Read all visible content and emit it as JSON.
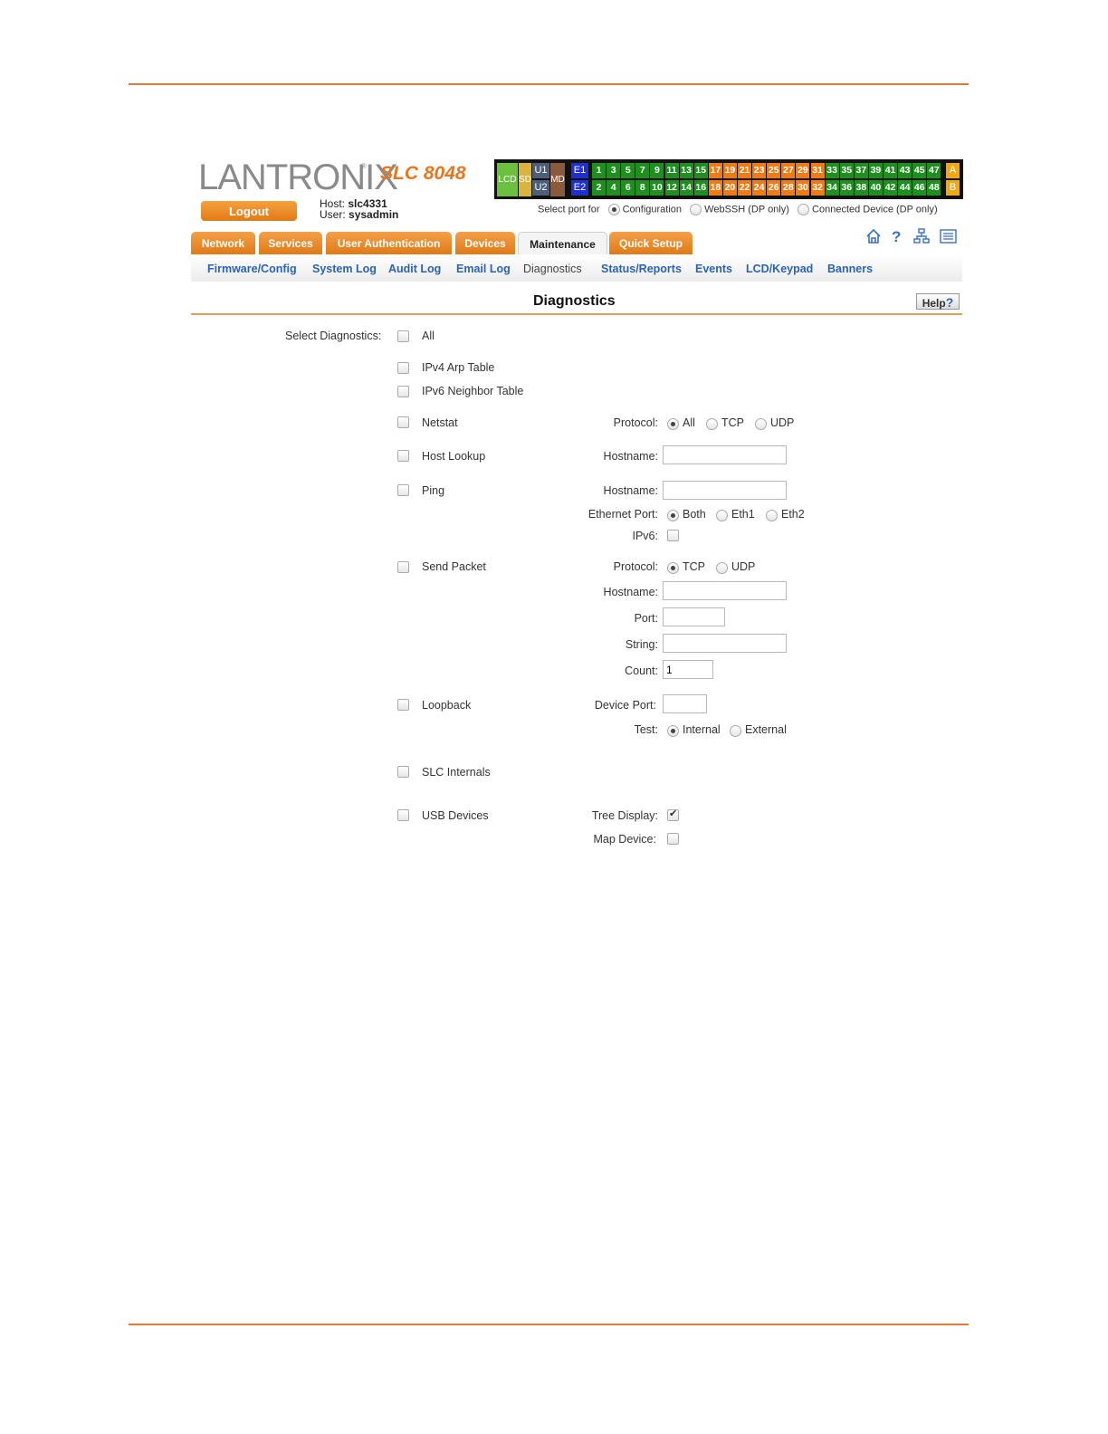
{
  "header": {
    "logo_text": "LANTRONIX",
    "logo_mark": "®",
    "model": "SLC 8048",
    "logout_label": "Logout",
    "host_label": "Host:",
    "host_value": "slc4331",
    "user_label": "User:",
    "user_value": "sysadmin"
  },
  "port_panel": {
    "lcd": "LCD",
    "sd": "SD",
    "u1": "U1",
    "u2": "U2",
    "md": "MD",
    "e1": "E1",
    "e2": "E2",
    "a": "A",
    "b": "B",
    "top_ports": [
      "1",
      "3",
      "5",
      "7",
      "9",
      "11",
      "13",
      "15",
      "17",
      "19",
      "21",
      "23",
      "25",
      "27",
      "29",
      "31",
      "33",
      "35",
      "37",
      "39",
      "41",
      "43",
      "45",
      "47"
    ],
    "bottom_ports": [
      "2",
      "4",
      "6",
      "8",
      "10",
      "12",
      "14",
      "16",
      "18",
      "20",
      "22",
      "24",
      "26",
      "28",
      "30",
      "32",
      "34",
      "36",
      "38",
      "40",
      "42",
      "44",
      "46",
      "48"
    ],
    "colors": {
      "green": "#1f8f1f",
      "orange": "#f07a14",
      "blue": "#1f2fd0",
      "lcd": "#6cc040",
      "sd": "#d8b53c",
      "u": "#4f5e78",
      "md": "#8a5a3c",
      "ab": "#f0a818"
    }
  },
  "select_port": {
    "label": "Select port for",
    "options": [
      "Configuration",
      "WebSSH (DP only)",
      "Connected Device (DP only)"
    ],
    "selected": "Configuration"
  },
  "tabs": [
    "Network",
    "Services",
    "User Authentication",
    "Devices",
    "Maintenance",
    "Quick Setup"
  ],
  "active_tab": "Maintenance",
  "nav_icons": [
    "home-icon",
    "help-icon",
    "sitemap-icon",
    "list-icon"
  ],
  "subnav": [
    "Firmware/Config",
    "System Log",
    "Audit Log",
    "Email Log",
    "Diagnostics",
    "Status/Reports",
    "Events",
    "LCD/Keypad",
    "Banners"
  ],
  "current_subnav": "Diagnostics",
  "page": {
    "title": "Diagnostics",
    "help_label": "Help",
    "help_mark": "?"
  },
  "form": {
    "select_label": "Select Diagnostics:",
    "items": {
      "all": "All",
      "ipv4": "IPv4 Arp Table",
      "ipv6": "IPv6 Neighbor Table",
      "netstat": "Netstat",
      "hostlookup": "Host Lookup",
      "ping": "Ping",
      "sendpacket": "Send Packet",
      "loopback": "Loopback",
      "slc": "SLC Internals",
      "usb": "USB Devices"
    },
    "netstat": {
      "protocol_label": "Protocol:",
      "options": [
        "All",
        "TCP",
        "UDP"
      ],
      "selected": "All"
    },
    "hostlookup": {
      "hostname_label": "Hostname:",
      "hostname": ""
    },
    "ping": {
      "hostname_label": "Hostname:",
      "hostname": "",
      "eth_label": "Ethernet Port:",
      "eth_options": [
        "Both",
        "Eth1",
        "Eth2"
      ],
      "eth_selected": "Both",
      "ipv6_label": "IPv6:",
      "ipv6": false
    },
    "sendpacket": {
      "protocol_label": "Protocol:",
      "options": [
        "TCP",
        "UDP"
      ],
      "selected": "TCP",
      "hostname_label": "Hostname:",
      "hostname": "",
      "port_label": "Port:",
      "port": "",
      "string_label": "String:",
      "string": "",
      "count_label": "Count:",
      "count": "1"
    },
    "loopback": {
      "device_port_label": "Device Port:",
      "device_port": "",
      "test_label": "Test:",
      "options": [
        "Internal",
        "External"
      ],
      "selected": "Internal"
    },
    "usb": {
      "tree_label": "Tree Display:",
      "tree": true,
      "map_label": "Map Device:",
      "map": false
    }
  }
}
